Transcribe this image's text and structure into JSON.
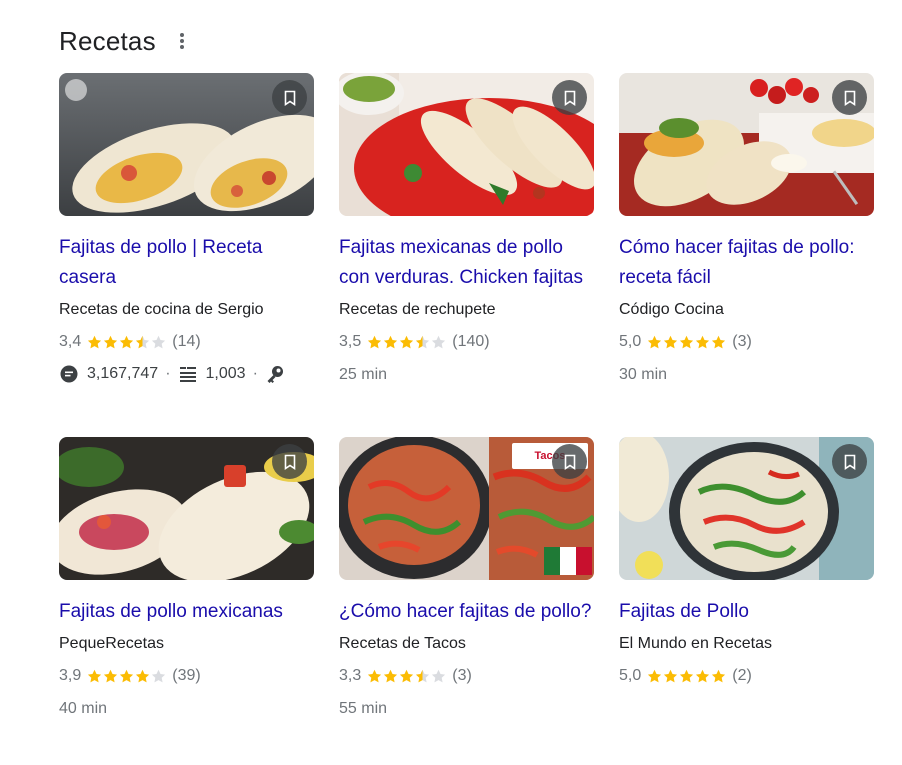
{
  "header": {
    "title": "Recetas"
  },
  "colors": {
    "link": "#1a0dab",
    "star": "#fbbc04",
    "star_empty": "#dadce0",
    "meta": "#70757a"
  },
  "recipes": [
    {
      "title": "Fajitas de pollo | Receta casera",
      "source": "Recetas de cocina de Sergio",
      "rating": "3,4",
      "stars": 3.5,
      "count": "(14)",
      "stats": {
        "views": "3,167,747",
        "ingredients": "1,003"
      }
    },
    {
      "title": "Fajitas mexicanas de pollo con verduras. Chicken fajitas",
      "source": "Recetas de rechupete",
      "rating": "3,5",
      "stars": 3.5,
      "count": "(140)",
      "time": "25 min"
    },
    {
      "title": "Cómo hacer fajitas de pollo: receta fácil",
      "source": "Código Cocina",
      "rating": "5,0",
      "stars": 5,
      "count": "(3)",
      "time": "30 min"
    },
    {
      "title": "Fajitas de pollo mexicanas",
      "source": "PequeRecetas",
      "rating": "3,9",
      "stars": 4,
      "count": "(39)",
      "time": "40 min"
    },
    {
      "title": "¿Cómo hacer fajitas de pollo?",
      "source": "Recetas de Tacos",
      "rating": "3,3",
      "stars": 3.5,
      "count": "(3)",
      "time": "55 min",
      "thumb_badge": "Tacos"
    },
    {
      "title": "Fajitas de Pollo",
      "source": "El Mundo en Recetas",
      "rating": "5,0",
      "stars": 5,
      "count": "(2)",
      "time": ""
    }
  ]
}
